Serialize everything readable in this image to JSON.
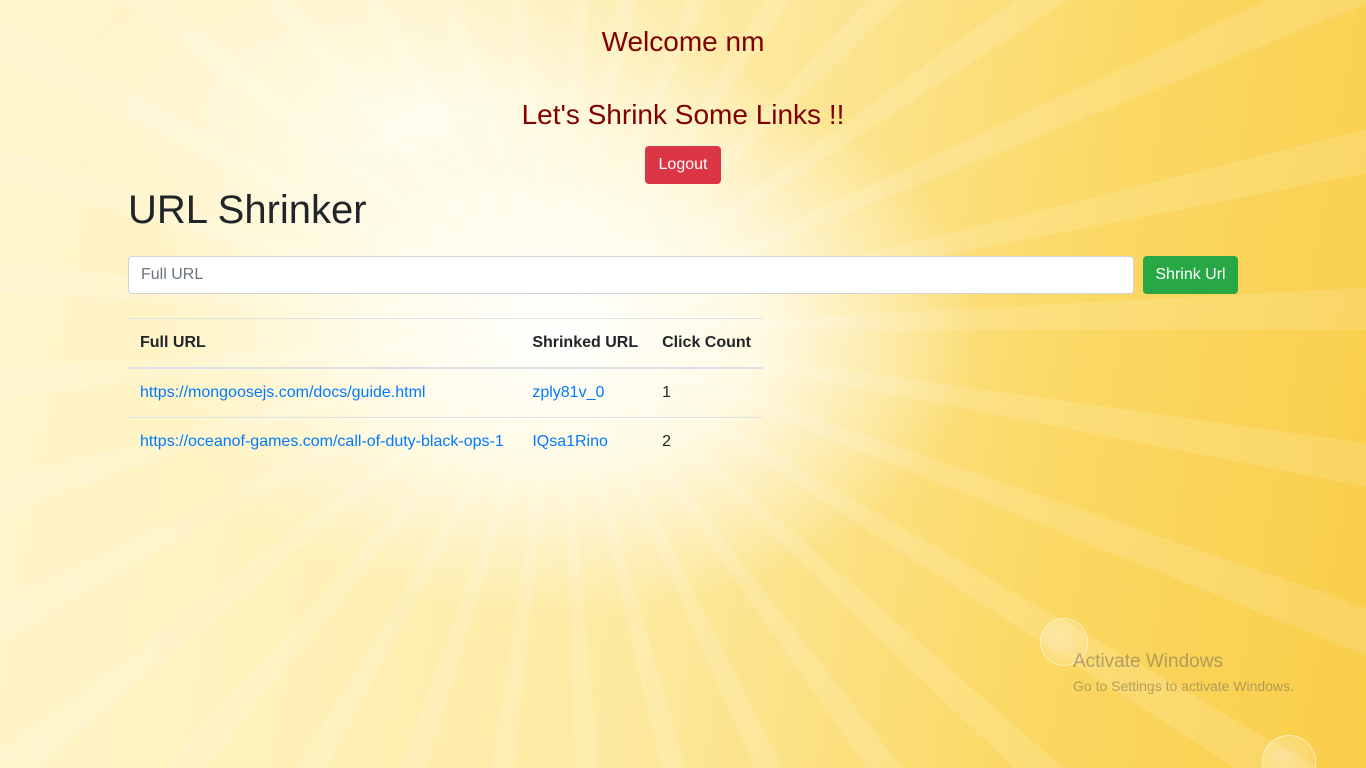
{
  "header": {
    "welcome": "Welcome nm",
    "tagline": "Let's Shrink Some Links !!",
    "logout_label": "Logout"
  },
  "main": {
    "title": "URL Shrinker",
    "input_placeholder": "Full URL",
    "input_value": "",
    "shrink_label": "Shrink Url"
  },
  "table": {
    "headers": [
      "Full URL",
      "Shrinked URL",
      "Click Count"
    ],
    "rows": [
      {
        "full": "https://mongoosejs.com/docs/guide.html",
        "short": "zply81v_0",
        "clicks": "1"
      },
      {
        "full": "https://oceanof-games.com/call-of-duty-black-ops-1",
        "short": "IQsa1Rino",
        "clicks": "2"
      }
    ]
  },
  "watermark": {
    "title": "Activate Windows",
    "subtitle": "Go to Settings to activate Windows."
  },
  "colors": {
    "heading": "#800000",
    "logout": "#dc3545",
    "shrink": "#28a745",
    "link": "#007bff"
  }
}
